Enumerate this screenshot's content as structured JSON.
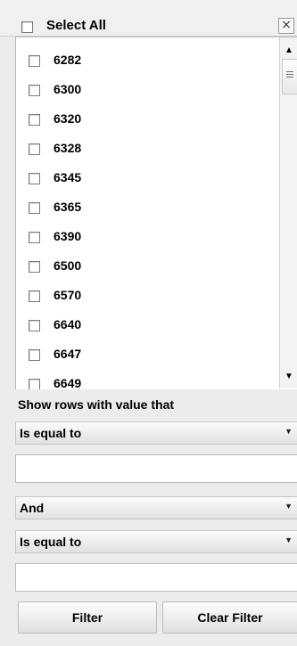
{
  "header": {
    "select_all_label": "Select All",
    "close_glyph": "×"
  },
  "list": {
    "items": [
      {
        "label": "6282",
        "checked": false
      },
      {
        "label": "6300",
        "checked": false
      },
      {
        "label": "6320",
        "checked": false
      },
      {
        "label": "6328",
        "checked": false
      },
      {
        "label": "6345",
        "checked": false
      },
      {
        "label": "6365",
        "checked": false
      },
      {
        "label": "6390",
        "checked": false
      },
      {
        "label": "6500",
        "checked": false
      },
      {
        "label": "6570",
        "checked": false
      },
      {
        "label": "6640",
        "checked": false
      },
      {
        "label": "6647",
        "checked": false
      },
      {
        "label": "6649",
        "checked": false
      }
    ]
  },
  "filter": {
    "show_rows_label": "Show rows with value that",
    "condition1": "Is equal to",
    "value1": "",
    "operator": "And",
    "condition2": "Is equal to",
    "value2": ""
  },
  "buttons": {
    "filter": "Filter",
    "clear_filter": "Clear Filter"
  },
  "icons": {
    "close": "close-icon",
    "dropdown": "chevron-down-icon",
    "scroll_up": "scroll-up-icon",
    "scroll_down": "scroll-down-icon"
  }
}
